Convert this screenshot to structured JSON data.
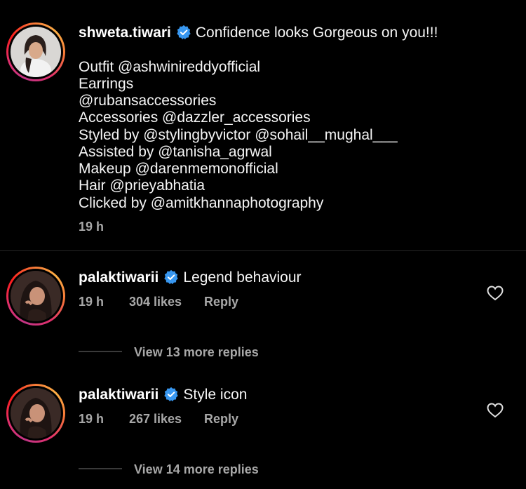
{
  "caption": {
    "username": "shweta.tiwari",
    "first_line": "Confidence looks Gorgeous on you!!!",
    "lines": [
      "Outfit @ashwinireddyofficial",
      "Earrings",
      "@rubansaccessories",
      "Accessories @dazzler_accessories",
      "Styled by @stylingbyvictor @sohail__mughal___",
      "Assisted by @tanisha_agrwal",
      "Makeup @darenmemonofficial",
      "Hair @prieyabhatia",
      "Clicked by @amitkhannaphotography"
    ],
    "time": "19 h"
  },
  "comments": [
    {
      "username": "palaktiwarii",
      "text": "Legend behaviour",
      "time": "19 h",
      "likes": "304 likes",
      "reply_label": "Reply",
      "view_replies": "View 13 more replies"
    },
    {
      "username": "palaktiwarii",
      "text": "Style icon",
      "time": "19 h",
      "likes": "267 likes",
      "reply_label": "Reply",
      "view_replies": "View 14 more replies"
    }
  ],
  "icons": {
    "verified": "verified-badge-icon",
    "like": "heart-icon"
  },
  "colors": {
    "background": "#000000",
    "text": "#f5f5f5",
    "secondary": "#a8a8a8",
    "verified": "#3897f0"
  }
}
